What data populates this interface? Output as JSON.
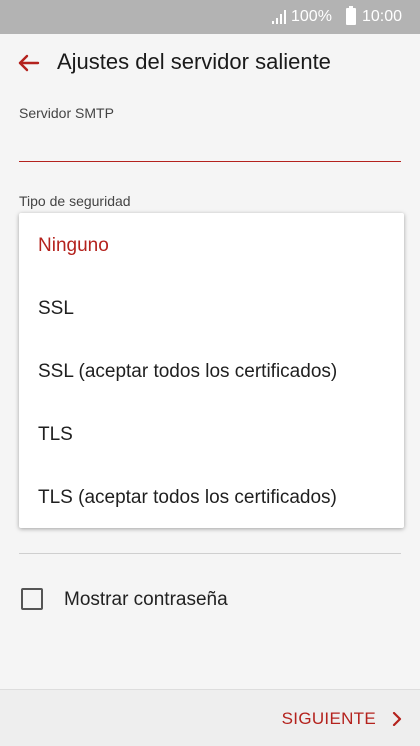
{
  "status_bar": {
    "battery_percent": "100%",
    "time": "10:00"
  },
  "header": {
    "title": "Ajustes del servidor saliente"
  },
  "form": {
    "smtp_label": "Servidor SMTP",
    "smtp_value": "",
    "security_label": "Tipo de seguridad"
  },
  "security_dropdown": {
    "selected": "Ninguno",
    "options": [
      "Ninguno",
      "SSL",
      "SSL (aceptar todos los certificados)",
      "TLS",
      "TLS (aceptar todos los certificados)"
    ]
  },
  "show_password": {
    "label": "Mostrar contraseña",
    "checked": false
  },
  "footer": {
    "next_label": "SIGUIENTE"
  },
  "colors": {
    "accent": "#b4221d",
    "status_bar": "#b3b3b3",
    "background": "#f5f5f5"
  },
  "icons": [
    "signal-icon",
    "battery-icon",
    "back-arrow-icon",
    "checkbox-icon",
    "chevron-right-icon"
  ]
}
